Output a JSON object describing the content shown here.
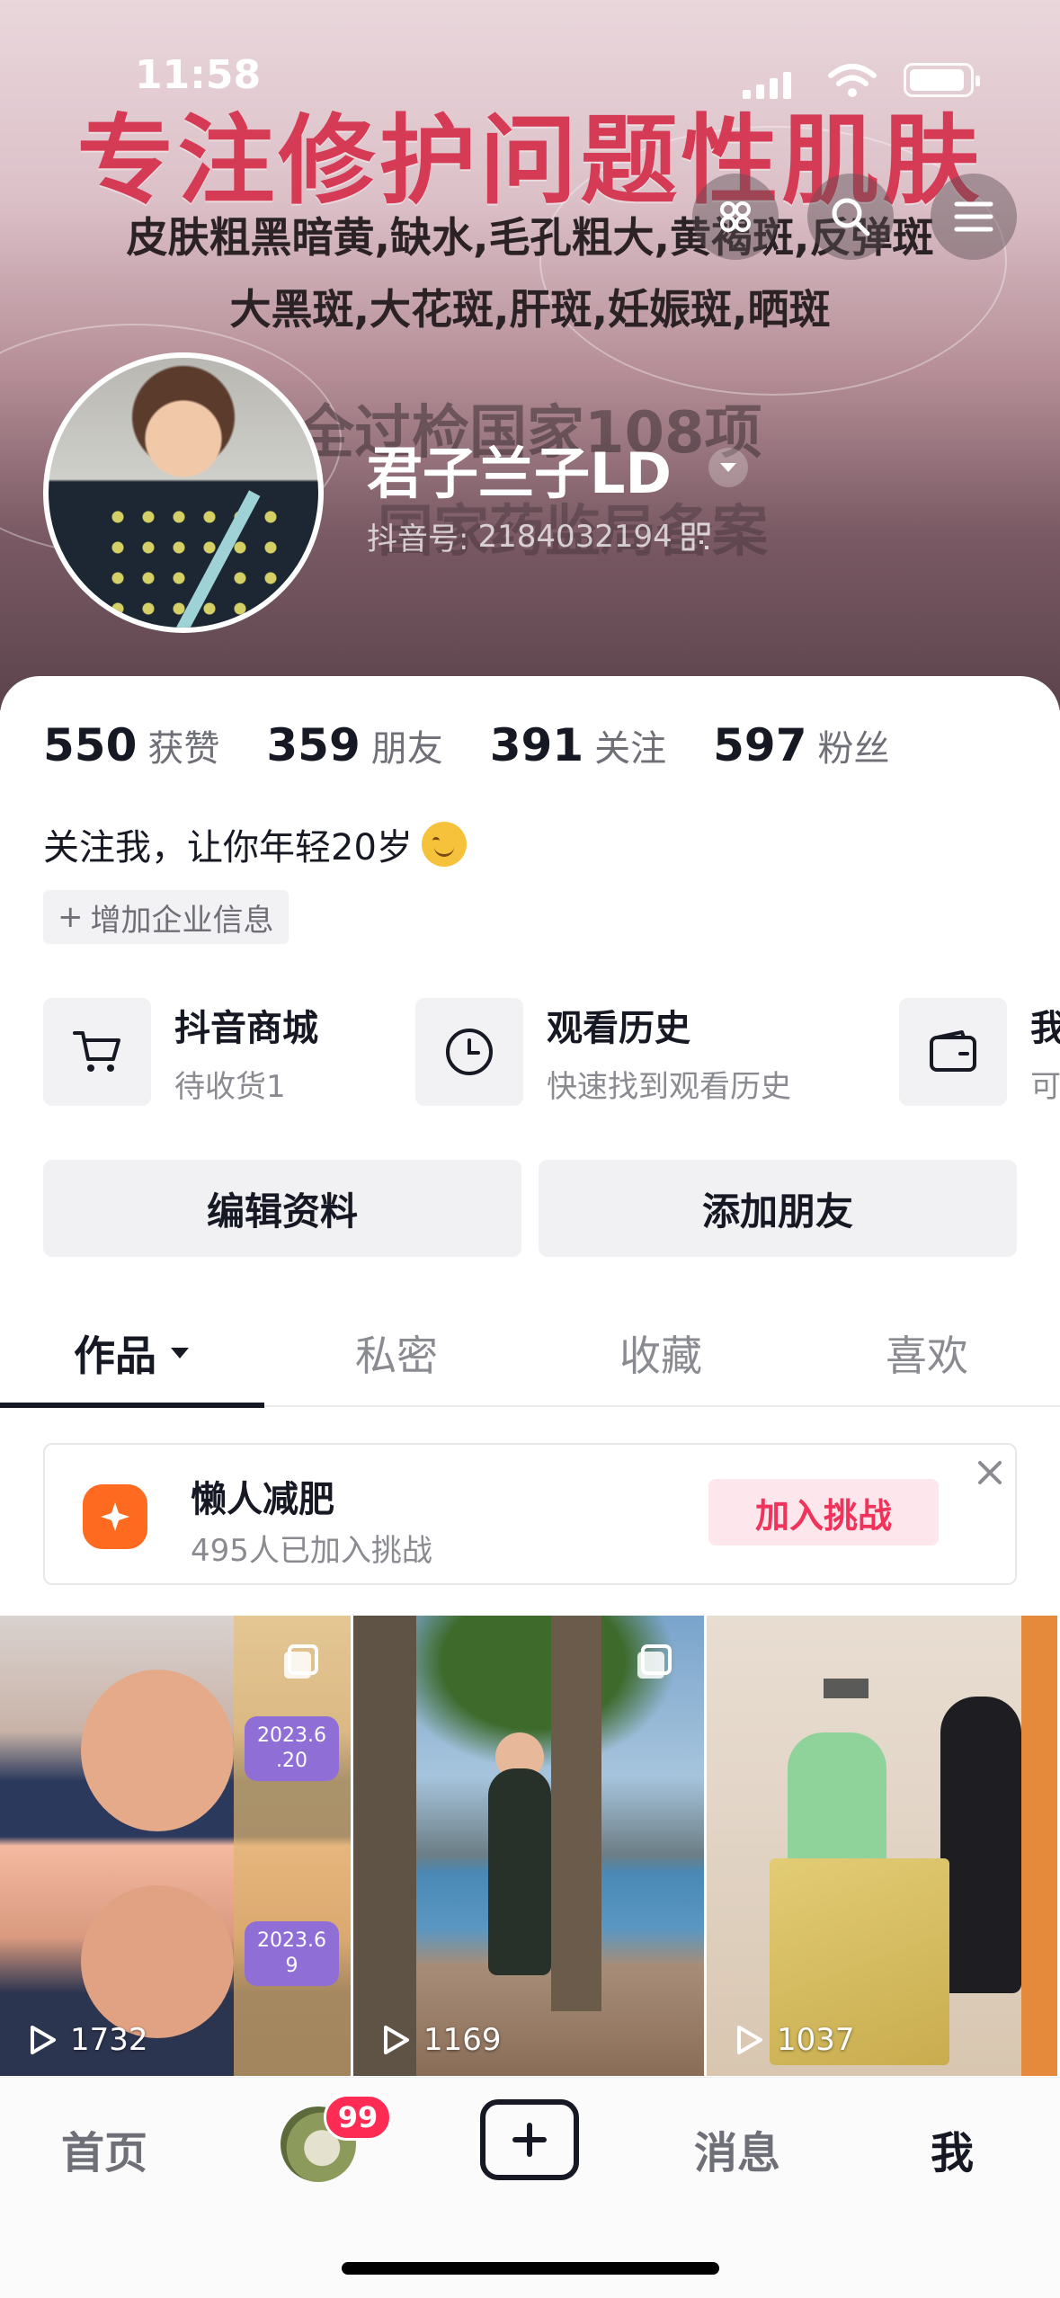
{
  "status_bar": {
    "time": "11:58"
  },
  "banner": {
    "headline": "专注修护问题性肌肤",
    "line1": "皮肤粗黑暗黄,缺水,毛孔粗大,黄褐斑,反弹斑",
    "line2": "大黑斑,大花斑,肝斑,妊娠斑,晒斑",
    "faded1": "全过检国家108项",
    "faded2": "国家药监局备案"
  },
  "profile": {
    "name": "君子兰子LD",
    "id_label": "抖音号:",
    "id_value": "2184032194",
    "bio": "关注我，让你年轻20岁",
    "add_business": "增加企业信息"
  },
  "stats": [
    {
      "num": "550",
      "label": "获赞"
    },
    {
      "num": "359",
      "label": "朋友"
    },
    {
      "num": "391",
      "label": "关注"
    },
    {
      "num": "597",
      "label": "粉丝"
    }
  ],
  "services": {
    "mall": {
      "title": "抖音商城",
      "subtitle": "待收货1",
      "icon": "cart-icon"
    },
    "history": {
      "title": "观看历史",
      "subtitle": "快速找到观看历史",
      "icon": "clock-icon"
    },
    "wallet": {
      "title": "我",
      "subtitle": "可",
      "icon": "wallet-icon"
    }
  },
  "actions": {
    "edit": "编辑资料",
    "add_friend": "添加朋友"
  },
  "tabs": [
    {
      "label": "作品"
    },
    {
      "label": "私密"
    },
    {
      "label": "收藏"
    },
    {
      "label": "喜欢"
    }
  ],
  "challenge": {
    "title": "懒人减肥",
    "subtitle": "495人已加入挑战",
    "join": "加入挑战"
  },
  "videos": [
    {
      "plays": "1732",
      "tag1": "2023.6\n.20",
      "tag2": "2023.6\n9"
    },
    {
      "plays": "1169"
    },
    {
      "plays": "1037"
    }
  ],
  "nav": {
    "home": "首页",
    "badge": "99",
    "messages": "消息",
    "me": "我"
  },
  "colors": {
    "accent": "#fe2c55",
    "challenge_orange": "#fe6a1f",
    "text": "#161823"
  }
}
